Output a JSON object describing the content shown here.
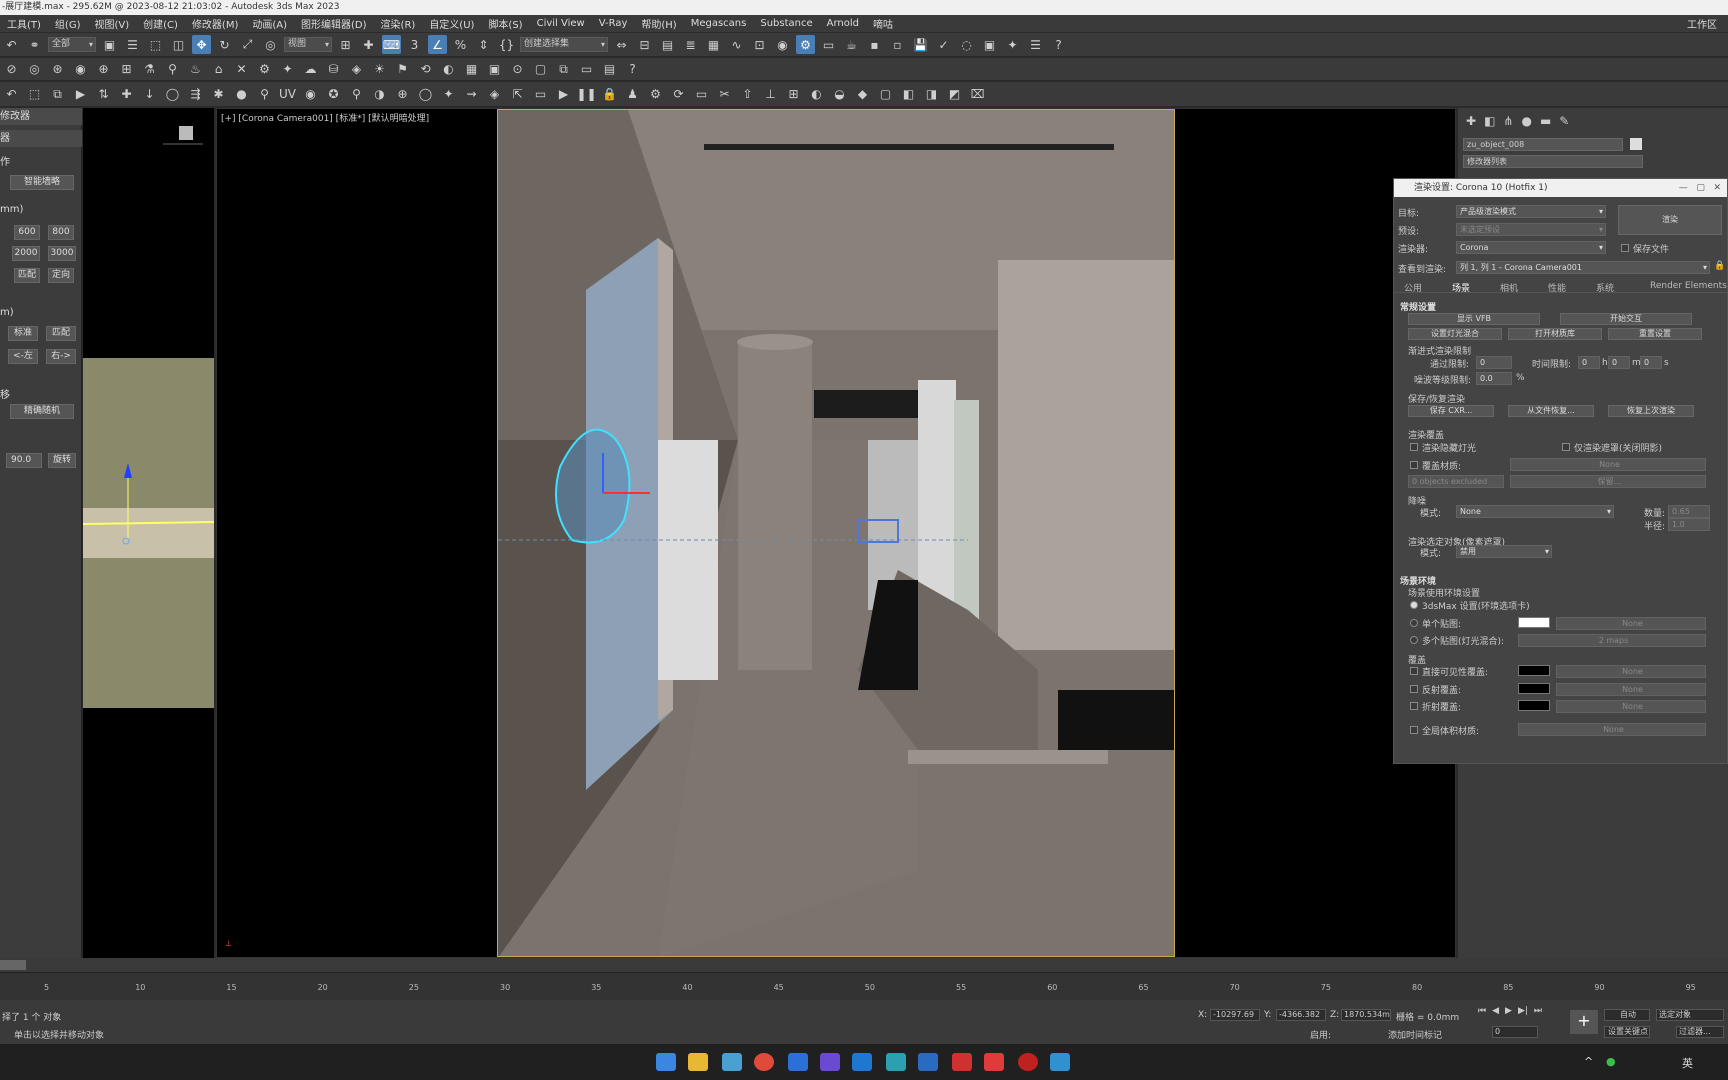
{
  "app": {
    "title": "-展厅建模.max - 295.62M @ 2023-08-12 21:03:02 - Autodesk 3ds Max 2023",
    "workspace": "工作区"
  },
  "menu": [
    "工具(T)",
    "组(G)",
    "视图(V)",
    "创建(C)",
    "修改器(M)",
    "动画(A)",
    "图形编辑器(D)",
    "渲染(R)",
    "自定义(U)",
    "脚本(S)",
    "Civil View",
    "V-Ray",
    "帮助(H)",
    "Megascans",
    "Substance",
    "Arnold",
    "嘀咕"
  ],
  "toolbar1": {
    "filter": "全部",
    "refcoord": "视图",
    "selset": "创建选择集"
  },
  "toolbar3": {
    "uv_label": "UV"
  },
  "left_panel": {
    "sec_modifier": "修改器",
    "sec_device": "器",
    "sec_op": "作",
    "smart_btn": "智能墙略",
    "unit_mm": "mm)",
    "sizes_row1": [
      "600",
      "800"
    ],
    "sizes_row2": [
      "2000",
      "3000"
    ],
    "match": "匹配",
    "orient": "定向",
    "unit_m": "m)",
    "standard": "标准",
    "match2": "匹配",
    "left": "<-左",
    "right": "右->",
    "offset": "移",
    "precise": "精确随机",
    "angle": "90.0",
    "rotate": "旋转"
  },
  "viewport": {
    "label": "[+] [Corona Camera001] [标准*] [默认明暗处理]"
  },
  "cmd_panel": {
    "object_name": "zu_object_008",
    "modifier_list": "修改器列表"
  },
  "render_dialog": {
    "title": "渲染设置: Corona 10 (Hotfix 1)",
    "target_label": "目标:",
    "target_value": "产品级渲染模式",
    "preset_label": "预设:",
    "preset_value": "未选定预设",
    "renderer_label": "渲染器:",
    "renderer_value": "Corona",
    "save_file": "保存文件",
    "view_label": "查看到渲染:",
    "view_value": "列 1, 列 1 - Corona Camera001",
    "render_button": "渲染",
    "tabs": [
      "公用",
      "场景",
      "相机",
      "性能",
      "系统",
      "Render Elements"
    ],
    "sec_general": "常规设置",
    "show_vfb": "显示 VFB",
    "start_ipr": "开始交互",
    "lightmix": "设置灯光混合",
    "open_mtl": "打开材质库",
    "reset": "重置设置",
    "progressive": "渐进式渲染限制",
    "pass_limit_label": "通过限制:",
    "pass_limit": "0",
    "time_limit_label": "时间限制:",
    "time_h": "0",
    "time_m": "0",
    "time_s": "0",
    "h": "h",
    "m": "m",
    "s": "s",
    "noise_label": "噪波等级限制:",
    "noise": "0.0",
    "pct": "%",
    "saverestore": "保存/恢复渲染",
    "save_cxr": "保存 CXR...",
    "restore_file": "从文件恢复...",
    "restore_last": "恢复上次渲染",
    "override": "渲染覆盖",
    "hidden_lights": "渲染隐藏灯光",
    "only_mask": "仅渲染遮罩(关闭阴影)",
    "override_mtl": "覆盖材质:",
    "none": "None",
    "excluded": "0 objects excluded",
    "keep": "保留...",
    "denoise": "降噪",
    "mode_label": "模式:",
    "mode_value": "None",
    "amount_label": "数量:",
    "amount": "0.65",
    "radius_label": "半径:",
    "radius": "1.0",
    "selected": "渲染选定对象(像素遮罩)",
    "mode2_value": "禁用",
    "sec_env": "场景环境",
    "env_sub": "场景使用环境设置",
    "env_3dsmax": "3dsMax 设置(环境选项卡)",
    "single_map": "单个贴图:",
    "multi_map": "多个贴图(灯光混合):",
    "maps": "2 maps",
    "override_sec": "覆盖",
    "direct": "直接可见性覆盖:",
    "reflect": "反射覆盖:",
    "refract": "折射覆盖:",
    "global_vol": "全局体积材质:"
  },
  "timeline": {
    "ticks": [
      "5",
      "10",
      "15",
      "20",
      "25",
      "30",
      "35",
      "40",
      "45",
      "50",
      "55",
      "60",
      "65",
      "70",
      "75",
      "80",
      "85",
      "90",
      "95"
    ]
  },
  "status": {
    "selected": "择了 1 个 对象",
    "hint": "单击以选择并移动对象",
    "x_label": "X:",
    "x": "-10297.69",
    "y_label": "Y:",
    "y": "-4366.382",
    "z_label": "Z:",
    "z": "1870.534m",
    "grid": "栅格 = 0.0mm",
    "enable": "启用:",
    "add_time": "添加时间标记",
    "auto": "自动",
    "set_key": "设置关键点",
    "select_obj": "选定对象",
    "filter": "过滤器...",
    "frame": "0"
  },
  "taskbar": {
    "ime": "英"
  }
}
